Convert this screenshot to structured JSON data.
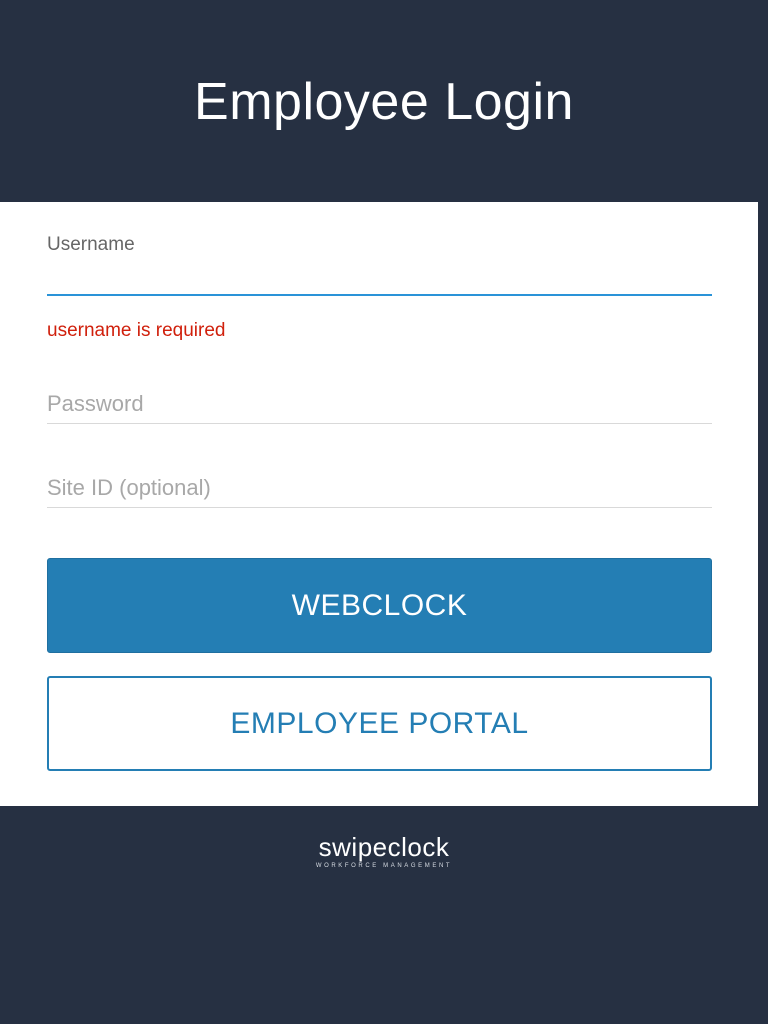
{
  "header": {
    "title": "Employee Login"
  },
  "form": {
    "username": {
      "label": "Username",
      "value": "",
      "error": "username is required"
    },
    "password": {
      "placeholder": "Password",
      "value": ""
    },
    "site_id": {
      "placeholder": "Site ID (optional)",
      "value": ""
    }
  },
  "buttons": {
    "webclock": "WEBCLOCK",
    "employee_portal": "EMPLOYEE PORTAL"
  },
  "brand": {
    "name": "swipeclock",
    "tagline": "WORKFORCE MANAGEMENT"
  },
  "colors": {
    "background": "#263042",
    "card": "#ffffff",
    "accent": "#247eb4",
    "focus_underline": "#2a93d8",
    "error": "#d0200c"
  }
}
